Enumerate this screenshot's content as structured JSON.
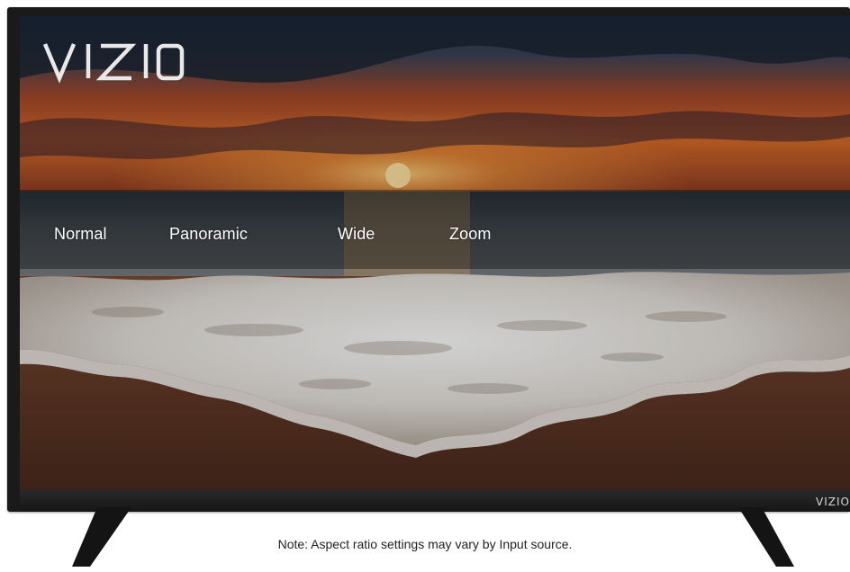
{
  "brand": {
    "screen_logo": "VIZIO",
    "bezel_logo": "VIZIO"
  },
  "aspect_menu": {
    "items": [
      {
        "label": "Normal"
      },
      {
        "label": "Panoramic"
      },
      {
        "label": "Wide"
      },
      {
        "label": "Zoom"
      }
    ]
  },
  "note": "Note: Aspect ratio settings may vary by Input source.",
  "colors": {
    "bezel": "#1a1a1a",
    "menu_text": "#ffffff",
    "menu_bar": "rgba(0,0,0,0.36)"
  }
}
